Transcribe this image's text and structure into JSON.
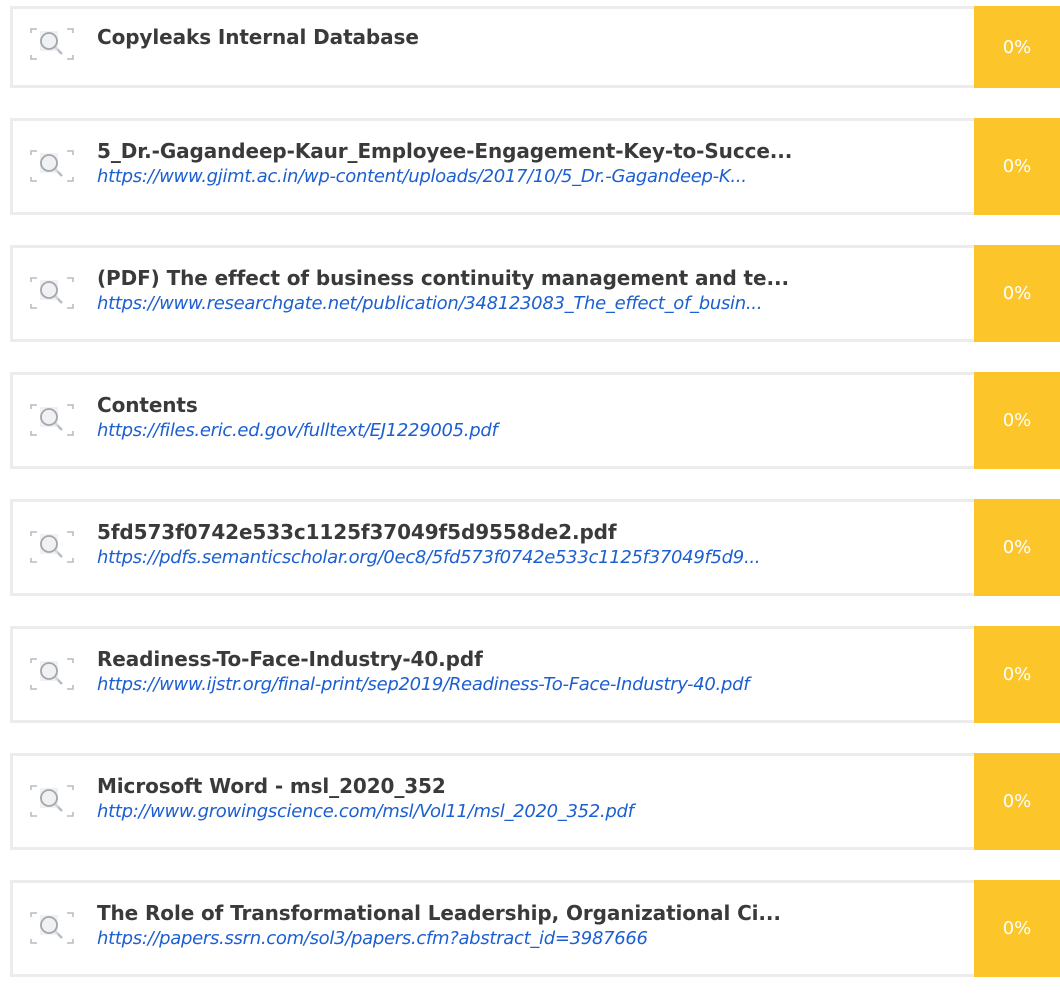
{
  "colors": {
    "badge": "#fcc62b",
    "url": "#1c5fd1",
    "title": "#3a3a3a",
    "border": "#ececec"
  },
  "results": [
    {
      "icon": "magnifier-document-icon",
      "title": "Copyleaks Internal Database",
      "url": "",
      "percent": "0%"
    },
    {
      "icon": "magnifier-document-icon",
      "title": "5_Dr.-Gagandeep-Kaur_Employee-Engagement-Key-to-Succe...",
      "url": "https://www.gjimt.ac.in/wp-content/uploads/2017/10/5_Dr.-Gagandeep-K...",
      "percent": "0%"
    },
    {
      "icon": "magnifier-document-icon",
      "title": "(PDF) The effect of business continuity management and te...",
      "url": "https://www.researchgate.net/publication/348123083_The_effect_of_busin...",
      "percent": "0%"
    },
    {
      "icon": "magnifier-document-icon",
      "title": "Contents",
      "url": "https://files.eric.ed.gov/fulltext/EJ1229005.pdf",
      "percent": "0%"
    },
    {
      "icon": "magnifier-document-icon",
      "title": "5fd573f0742e533c1125f37049f5d9558de2.pdf",
      "url": "https://pdfs.semanticscholar.org/0ec8/5fd573f0742e533c1125f37049f5d9...",
      "percent": "0%"
    },
    {
      "icon": "magnifier-document-icon",
      "title": "Readiness-To-Face-Industry-40.pdf",
      "url": "https://www.ijstr.org/final-print/sep2019/Readiness-To-Face-Industry-40.pdf",
      "percent": "0%"
    },
    {
      "icon": "magnifier-document-icon",
      "title": "Microsoft Word - msl_2020_352",
      "url": "http://www.growingscience.com/msl/Vol11/msl_2020_352.pdf",
      "percent": "0%"
    },
    {
      "icon": "magnifier-document-icon",
      "title": "The Role of Transformational Leadership, Organizational Ci...",
      "url": "https://papers.ssrn.com/sol3/papers.cfm?abstract_id=3987666",
      "percent": "0%"
    }
  ]
}
